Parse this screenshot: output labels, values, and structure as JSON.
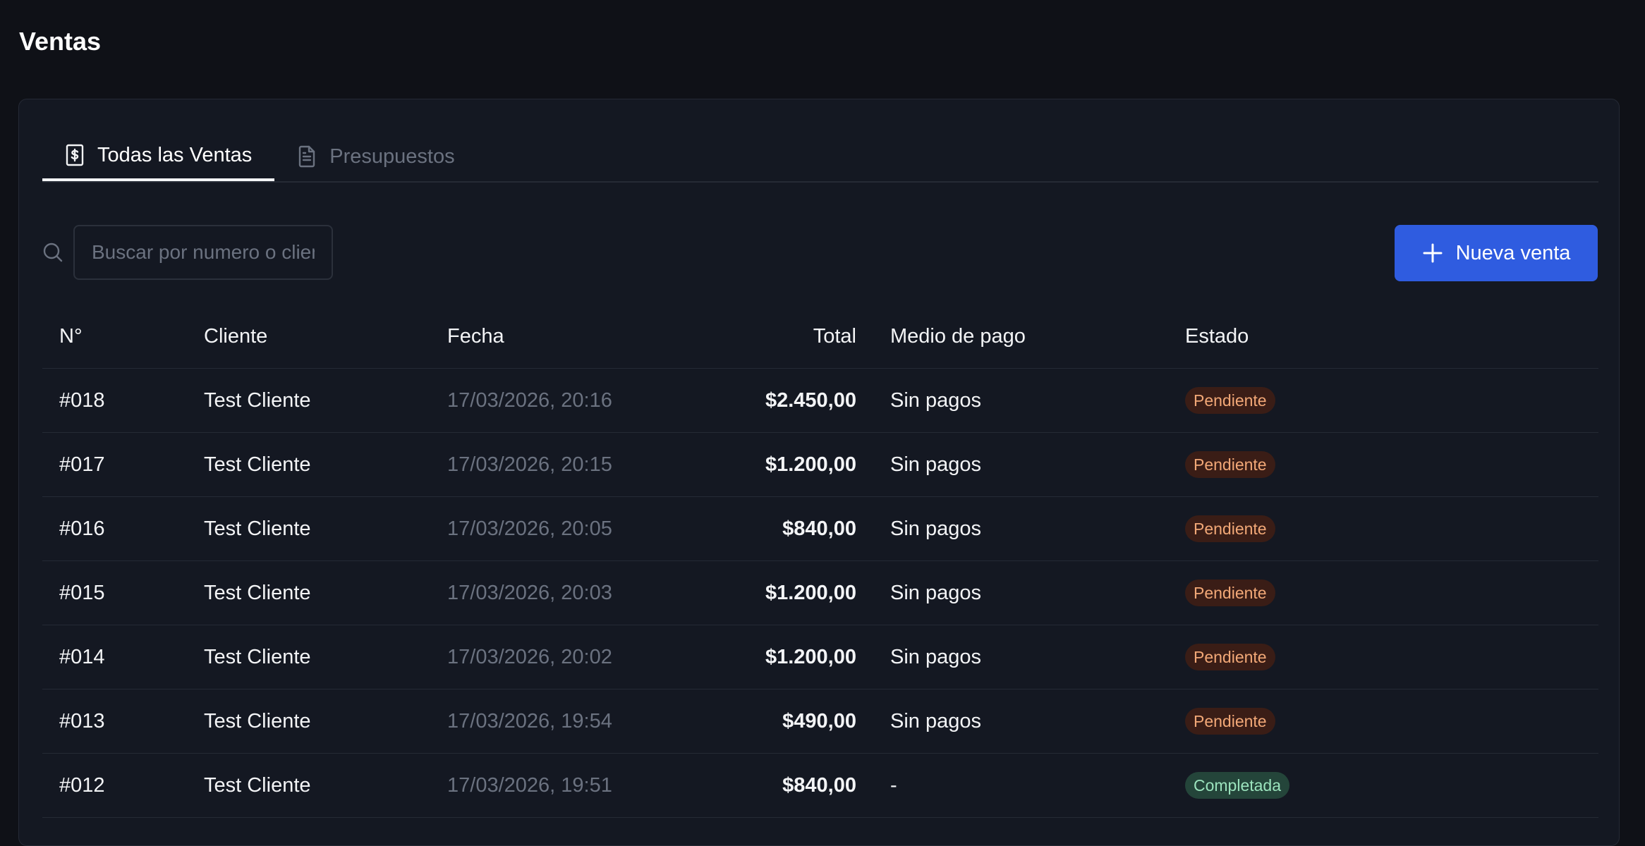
{
  "page": {
    "title": "Ventas"
  },
  "tabs": [
    {
      "label": "Todas las Ventas",
      "icon": "receipt-dollar-icon",
      "active": true
    },
    {
      "label": "Presupuestos",
      "icon": "document-icon",
      "active": false
    }
  ],
  "search": {
    "placeholder": "Buscar por numero o cliente",
    "value": ""
  },
  "toolbar": {
    "new_sale_label": "Nueva venta",
    "new_sale_icon": "plus-icon"
  },
  "table": {
    "headers": {
      "num": "N°",
      "cliente": "Cliente",
      "fecha": "Fecha",
      "total": "Total",
      "medio": "Medio de pago",
      "estado": "Estado"
    },
    "rows": [
      {
        "num": "#018",
        "cliente": "Test Cliente",
        "fecha": "17/03/2026, 20:16",
        "total": "$2.450,00",
        "medio": "Sin pagos",
        "estado": "Pendiente",
        "estado_kind": "pendiente"
      },
      {
        "num": "#017",
        "cliente": "Test Cliente",
        "fecha": "17/03/2026, 20:15",
        "total": "$1.200,00",
        "medio": "Sin pagos",
        "estado": "Pendiente",
        "estado_kind": "pendiente"
      },
      {
        "num": "#016",
        "cliente": "Test Cliente",
        "fecha": "17/03/2026, 20:05",
        "total": "$840,00",
        "medio": "Sin pagos",
        "estado": "Pendiente",
        "estado_kind": "pendiente"
      },
      {
        "num": "#015",
        "cliente": "Test Cliente",
        "fecha": "17/03/2026, 20:03",
        "total": "$1.200,00",
        "medio": "Sin pagos",
        "estado": "Pendiente",
        "estado_kind": "pendiente"
      },
      {
        "num": "#014",
        "cliente": "Test Cliente",
        "fecha": "17/03/2026, 20:02",
        "total": "$1.200,00",
        "medio": "Sin pagos",
        "estado": "Pendiente",
        "estado_kind": "pendiente"
      },
      {
        "num": "#013",
        "cliente": "Test Cliente",
        "fecha": "17/03/2026, 19:54",
        "total": "$490,00",
        "medio": "Sin pagos",
        "estado": "Pendiente",
        "estado_kind": "pendiente"
      },
      {
        "num": "#012",
        "cliente": "Test Cliente",
        "fecha": "17/03/2026, 19:51",
        "total": "$840,00",
        "medio": "-",
        "estado": "Completada",
        "estado_kind": "completada"
      }
    ]
  },
  "colors": {
    "background": "#0f1117",
    "card": "#141822",
    "accent": "#2f5ce0",
    "pending_bg": "#3a1d16",
    "pending_text": "#f2a877",
    "completed_bg": "#24453a",
    "completed_text": "#9be3bd"
  }
}
